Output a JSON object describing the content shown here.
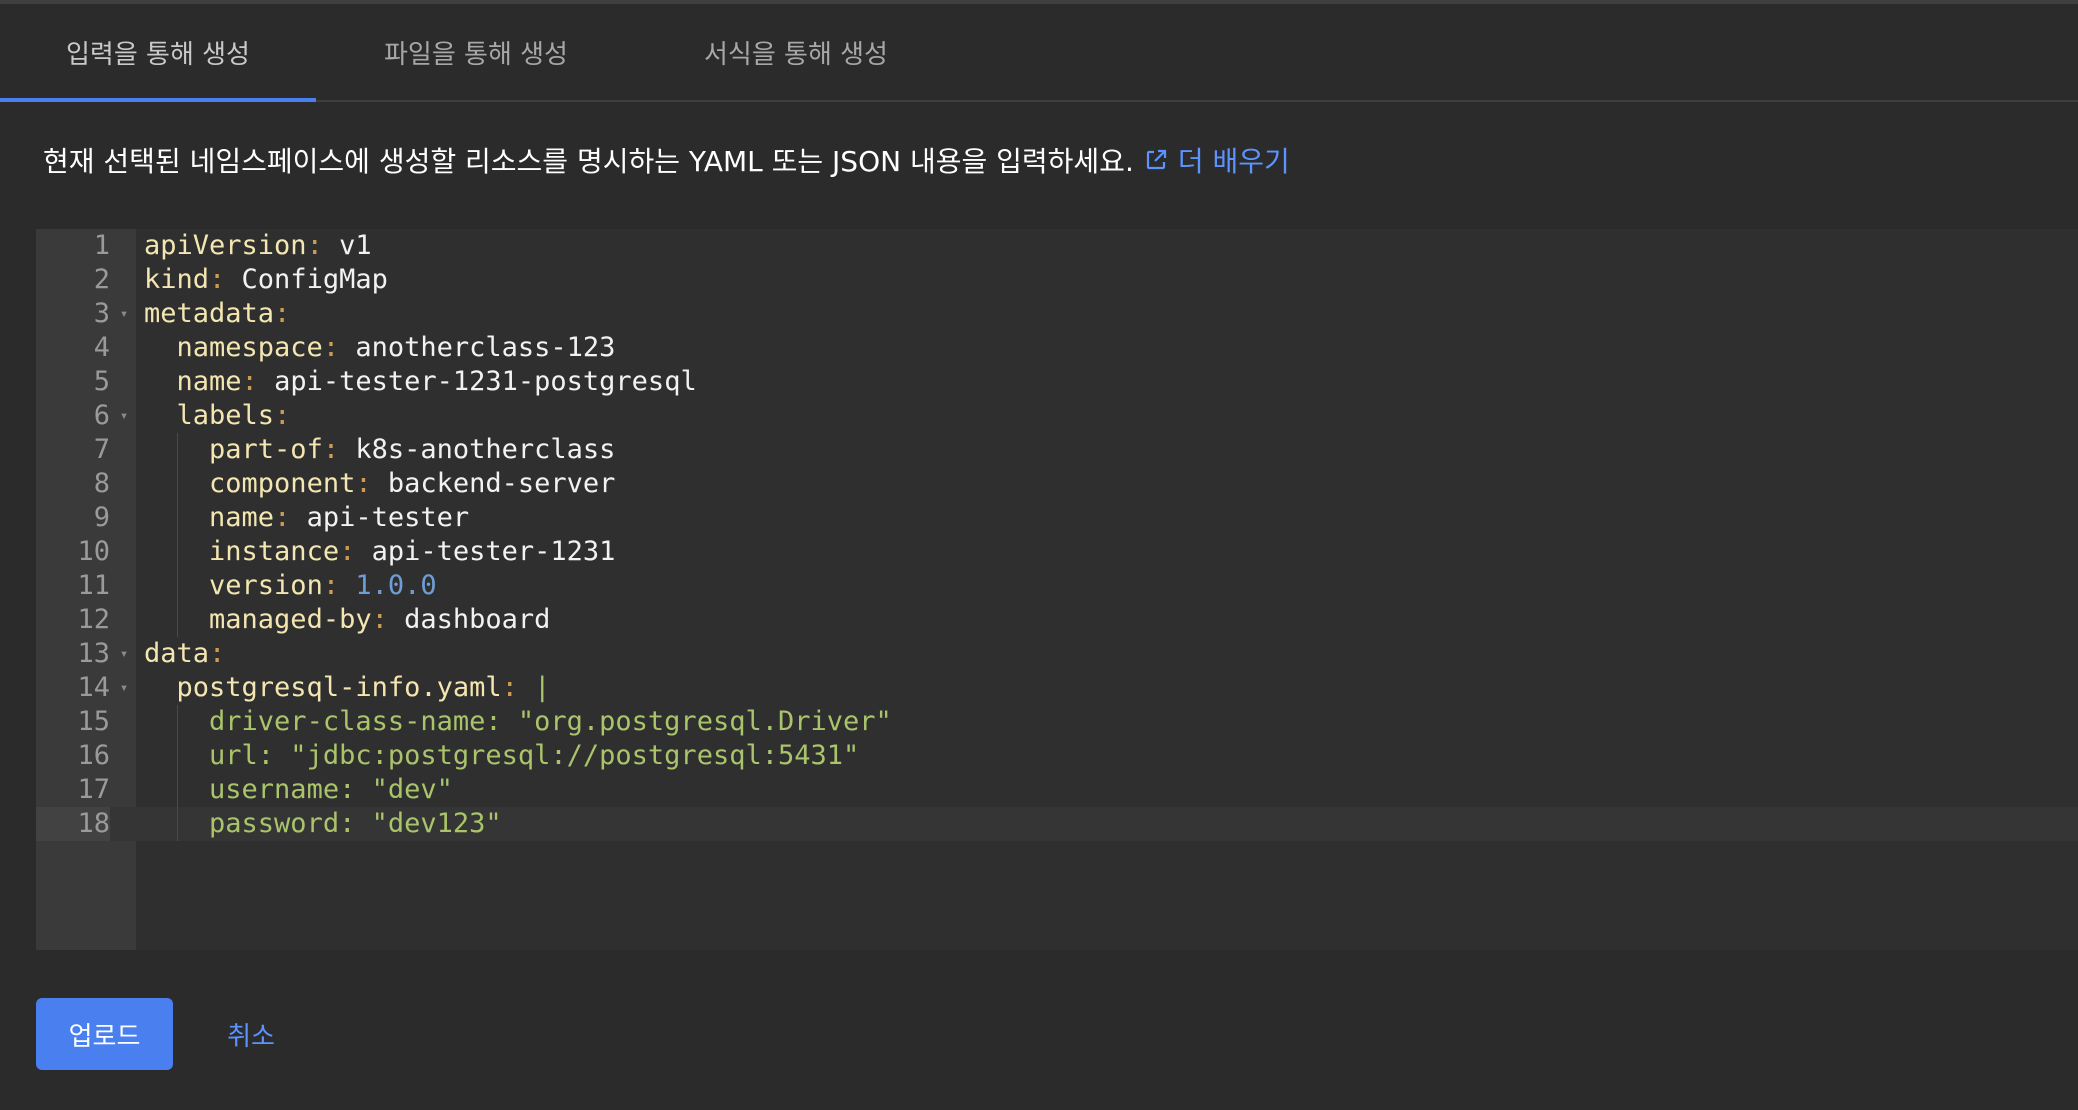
{
  "tabs": [
    {
      "label": "입력을 통해 생성",
      "active": true
    },
    {
      "label": "파일을 통해 생성",
      "active": false
    },
    {
      "label": "서식을 통해 생성",
      "active": false
    }
  ],
  "description": {
    "text": "현재 선택된 네임스페이스에 생성할 리소스를 명시하는 YAML 또는 JSON 내용을 입력하세요.",
    "link_label": "더 배우기",
    "link_icon": "external-link-icon"
  },
  "editor": {
    "lines": [
      {
        "num": "1"
      },
      {
        "num": "2"
      },
      {
        "num": "3"
      },
      {
        "num": "4"
      },
      {
        "num": "5"
      },
      {
        "num": "6"
      },
      {
        "num": "7"
      },
      {
        "num": "8"
      },
      {
        "num": "9"
      },
      {
        "num": "10"
      },
      {
        "num": "11"
      },
      {
        "num": "12"
      },
      {
        "num": "13"
      },
      {
        "num": "14"
      },
      {
        "num": "15"
      },
      {
        "num": "16"
      },
      {
        "num": "17"
      },
      {
        "num": "18"
      }
    ],
    "tokens": {
      "l1k": "apiVersion",
      "l1v": "v1",
      "l2k": "kind",
      "l2v": "ConfigMap",
      "l3k": "metadata",
      "l4k": "namespace",
      "l4v": "anotherclass-123",
      "l5k": "name",
      "l5v": "api-tester-1231-postgresql",
      "l6k": "labels",
      "l7k": "part-of",
      "l7v": "k8s-anotherclass",
      "l8k": "component",
      "l8v": "backend-server",
      "l9k": "name",
      "l9v": "api-tester",
      "l10k": "instance",
      "l10v": "api-tester-1231",
      "l11k": "version",
      "l11v": "1.0.0",
      "l12k": "managed-by",
      "l12v": "dashboard",
      "l13k": "data",
      "l14k": "postgresql-info.yaml",
      "l14v": "|",
      "l15s": "driver-class-name: \"org.postgresql.Driver\"",
      "l16s": "url: \"jdbc:postgresql://postgresql:5431\"",
      "l17s": "username: \"dev\"",
      "l18s": "password: \"dev123\""
    },
    "colors": {
      "key": "#f3e6b0",
      "colon": "#cf9b52",
      "number": "#6f9ed6",
      "string": "#a9c46a"
    }
  },
  "buttons": {
    "upload": "업로드",
    "cancel": "취소"
  },
  "accent_color": "#4a7ff0"
}
